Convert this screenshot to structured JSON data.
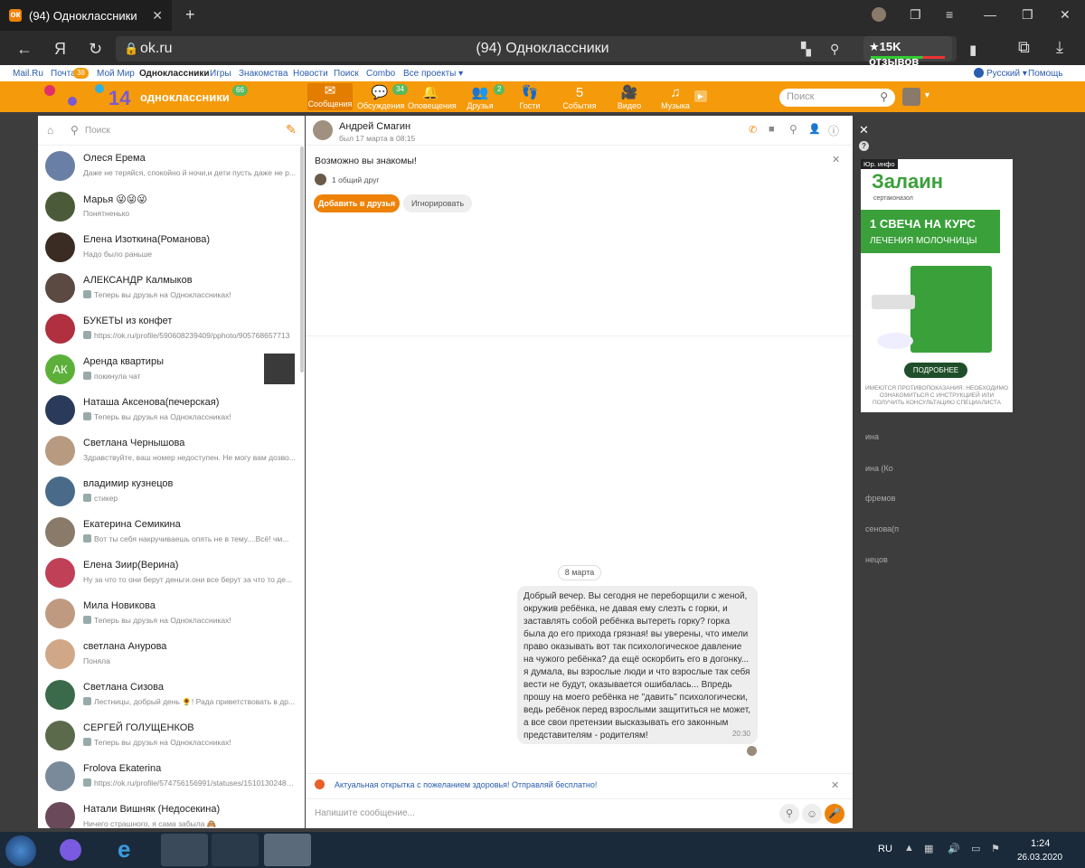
{
  "browser": {
    "tab_title": "(94) Одноклассники",
    "url": "ok.ru",
    "page_title": "(94) Одноклассники",
    "reviews": "★15K отзывов"
  },
  "portal": {
    "links": [
      "Mail.Ru",
      "Почта",
      "Мой Мир",
      "Одноклассники",
      "Игры",
      "Знакомства",
      "Новости",
      "Поиск",
      "Combo",
      "Все проекты ▾"
    ],
    "mail_badge": "38",
    "lang": "Русский ▾",
    "help": "Помощь"
  },
  "ok": {
    "logo": "одноклассники",
    "logo_badge": "66",
    "toolbar": [
      {
        "label": "Сообщения",
        "icon": "✉",
        "badge": ""
      },
      {
        "label": "Обсуждения",
        "icon": "💬",
        "badge": "34"
      },
      {
        "label": "Оповещения",
        "icon": "🔔",
        "badge": ""
      },
      {
        "label": "Друзья",
        "icon": "👥",
        "badge": "2"
      },
      {
        "label": "Гости",
        "icon": "👣",
        "badge": ""
      },
      {
        "label": "События",
        "icon": "5",
        "badge": ""
      },
      {
        "label": "Видео",
        "icon": "🎥",
        "badge": ""
      },
      {
        "label": "Музыка",
        "icon": "♫",
        "badge": ""
      }
    ],
    "search_placeholder": "Поиск"
  },
  "list": {
    "search_placeholder": "Поиск",
    "items": [
      {
        "name": "Олеся Ерема",
        "preview": "Даже не теряйся, спокойно й ночи,и дети пусть даже не р...",
        "color": "#6a7fa5",
        "mini": false
      },
      {
        "name": "Марья 😜😜😜",
        "preview": "Понятненько",
        "color": "#4b5b3a",
        "mini": false
      },
      {
        "name": "Елена Изоткина(Романова)",
        "preview": "Надо было раньше",
        "color": "#3a2c22",
        "mini": false
      },
      {
        "name": "АЛЕКСАНДР Калмыков",
        "preview": "Теперь вы друзья на Одноклассниках!",
        "color": "#5a4a42",
        "mini": true
      },
      {
        "name": "БУКЕТЫ из конфет",
        "preview": "https://ok.ru/profile/590608239409/pphoto/905768657713",
        "color": "#b03040",
        "mini": true
      },
      {
        "name": "Аренда квартиры",
        "preview": "покинула чат",
        "color": "#5cb03a",
        "initials": "АК",
        "mini": true
      },
      {
        "name": "Наташа Аксенова(печерская)",
        "preview": "Теперь вы друзья на Одноклассниках!",
        "color": "#2a3a5a",
        "mini": true
      },
      {
        "name": "Светлана Чернышова",
        "preview": "Здравствуйте, ваш номер недоступен. Не могу вам дозво...",
        "color": "#b89a80",
        "mini": false
      },
      {
        "name": "владимир кузнецов",
        "preview": "стикер",
        "color": "#4a6a8a",
        "mini": true
      },
      {
        "name": "Екатерина Семикина",
        "preview": "Вот ты себя накручиваешь опять не в тему....Всё! чм...",
        "color": "#8a7a6a",
        "mini": true
      },
      {
        "name": "Елена Зиир(Верина)",
        "preview": "Ну за что то они берут деньги.они все берут за что то де...",
        "color": "#c04058",
        "mini": false
      },
      {
        "name": "Мила Новикова",
        "preview": "Теперь вы друзья на Одноклассниках!",
        "color": "#c09a80",
        "mini": true
      },
      {
        "name": "светлана Анурова",
        "preview": "Поняла",
        "color": "#d0a888",
        "mini": false
      },
      {
        "name": "Светлана Сизова",
        "preview": "Лестницы, добрый день 🌻! Рада приветствовать в др...",
        "color": "#3a6a4a",
        "mini": true
      },
      {
        "name": "СЕРГЕЙ ГОЛУЩЕНКОВ",
        "preview": "Теперь вы друзья на Одноклассниках!",
        "color": "#5a6a4a",
        "mini": true
      },
      {
        "name": "Frolova Ekaterina",
        "preview": "https://ok.ru/profile/574756156991/statuses/15101302487...",
        "color": "#7a8a9a",
        "mini": true
      },
      {
        "name": "Натали Вишняк (Недосекина)",
        "preview": "Ничего страшного, я сама забыла 🙈",
        "color": "#6a4a5a",
        "mini": false
      }
    ]
  },
  "conversation": {
    "name": "Андрей Смагин",
    "status": "был 17 марта в 08:15",
    "suggestion_title": "Возможно вы знакомы!",
    "mutual": "1 общий друг",
    "add_friend": "Добавить в друзья",
    "ignore": "Игнорировать",
    "date": "8 марта",
    "message": "Добрый вечер. Вы сегодня не переборщили с женой, окружив ребёнка, не давая  ему слезть с горки, и заставлять собой ребёнка вытереть горку? горка была до его прихода грязная! вы уверены, что имели право оказывать вот так психологическое давление на чужого ребёнка? да ещё оскорбить его в догонку... я думала, вы взрослые люди и что взрослые так себя вести не будут, оказывается ошибалась... Впредь прошу на моего ребёнка не \"давить\" психологически, ведь ребёнок перед взрослыми защититься не может, а все свои претензии высказывать его законным представителям - родителям!",
    "time": "20:30",
    "promo": "Актуальная открытка с пожеланием здоровья! Отправляй бесплатно!",
    "input_placeholder": "Напишите сообщение..."
  },
  "ad": {
    "label": "Юр. инфо",
    "brand": "Залаин",
    "sub": "сертаконазол",
    "headline1": "1 СВЕЧА НА КУРС",
    "headline2": "ЛЕЧЕНИЯ МОЛОЧНИЦЫ",
    "more": "ПОДРОБНЕЕ",
    "disclaimer": "ИМЕЮТСЯ ПРОТИВОПОКАЗАНИЯ. НЕОБХОДИМО ОЗНАКОМИТЬСЯ С ИНСТРУКЦИЕЙ ИЛИ ПОЛУЧИТЬ КОНСУЛЬТАЦИЮ СПЕЦИАЛИСТА"
  },
  "right_bg": [
    "ина",
    "ина (Ко",
    "фремов",
    "сенова(п",
    "нецов"
  ],
  "taskbar": {
    "lang": "RU",
    "time": "1:24",
    "date": "26.03.2020"
  }
}
